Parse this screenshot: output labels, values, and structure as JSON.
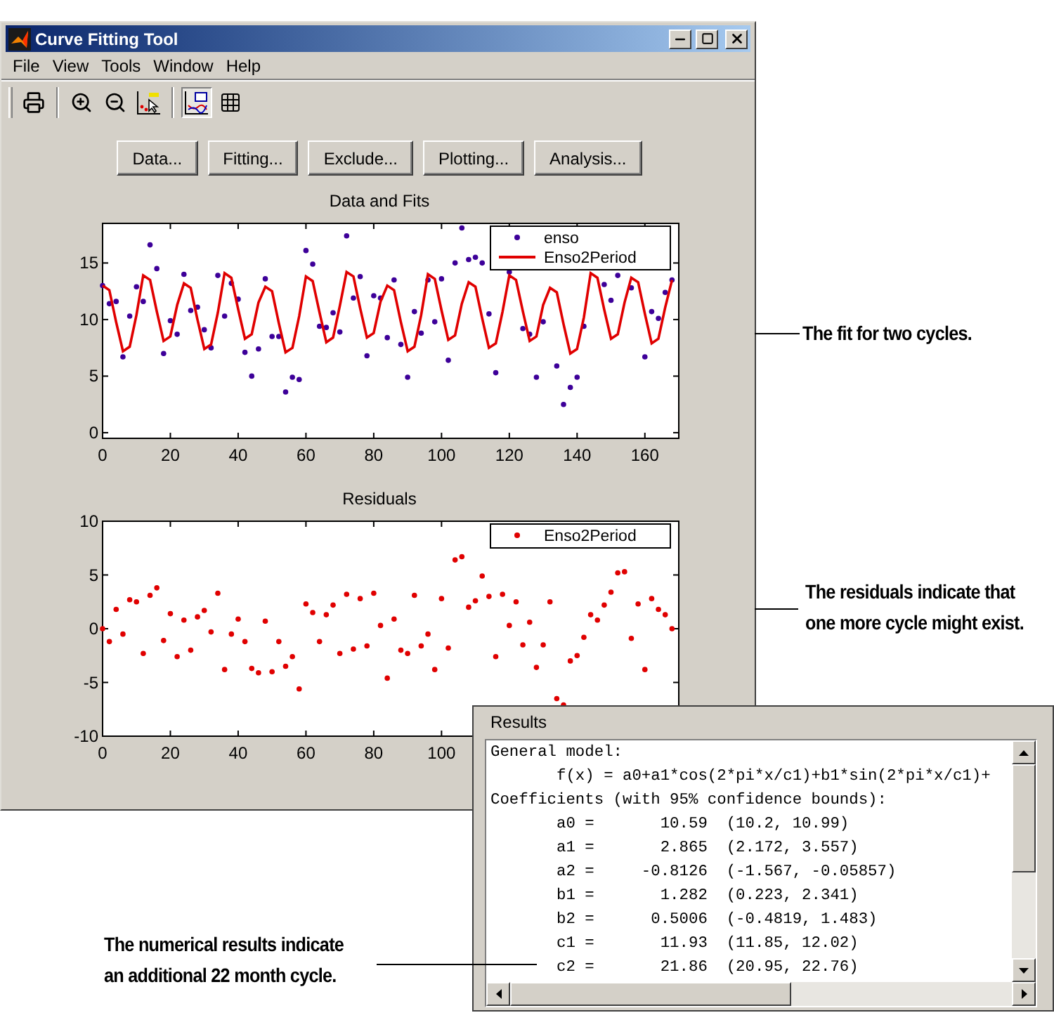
{
  "window": {
    "title": "Curve Fitting Tool"
  },
  "menu": [
    {
      "label": "File"
    },
    {
      "label": "View"
    },
    {
      "label": "Tools"
    },
    {
      "label": "Window"
    },
    {
      "label": "Help"
    }
  ],
  "toolbar": [
    {
      "kind": "printer",
      "pressed": false
    },
    {
      "kind": "zoom-in",
      "pressed": false
    },
    {
      "kind": "zoom-out",
      "pressed": false
    },
    {
      "kind": "data-cursor",
      "pressed": false
    },
    {
      "kind": "legend",
      "pressed": true
    },
    {
      "kind": "grid",
      "pressed": false
    }
  ],
  "buttons": [
    "Data...",
    "Fitting...",
    "Exclude...",
    "Plotting...",
    "Analysis..."
  ],
  "plots": [
    {
      "chart_data": {
        "type": "scatter",
        "title": "Data and Fits",
        "x": [
          0,
          2,
          4,
          6,
          8,
          10,
          12,
          14,
          16,
          18,
          20,
          22,
          24,
          26,
          28,
          30,
          32,
          34,
          36,
          38,
          40,
          42,
          44,
          46,
          48,
          50,
          52,
          54,
          56,
          58,
          60,
          62,
          64,
          66,
          68,
          70,
          72,
          74,
          76,
          78,
          80,
          82,
          84,
          86,
          88,
          90,
          92,
          94,
          96,
          98,
          100,
          102,
          104,
          106,
          108,
          110,
          112,
          114,
          116,
          118,
          120,
          122,
          124,
          126,
          128,
          130,
          132,
          134,
          136,
          138,
          140,
          142,
          144,
          146,
          148,
          150,
          152,
          154,
          156,
          158,
          160,
          162,
          164,
          166,
          168
        ],
        "xlim": [
          0,
          170
        ],
        "ylim": [
          -0.5,
          18.5
        ],
        "xticks": [
          0,
          20,
          40,
          60,
          80,
          100,
          120,
          140,
          160
        ],
        "yticks": [
          0,
          5,
          10,
          15
        ],
        "series": [
          {
            "name": "enso",
            "type": "scatter",
            "color": "#3d0099",
            "values": [
              13.0,
              11.4,
              11.6,
              6.7,
              10.3,
              12.9,
              11.6,
              16.6,
              14.5,
              7.0,
              9.9,
              8.7,
              14.0,
              10.8,
              11.1,
              9.1,
              7.5,
              13.9,
              10.3,
              13.2,
              11.8,
              7.1,
              5.0,
              7.4,
              13.6,
              8.5,
              8.5,
              3.6,
              4.9,
              4.7,
              16.1,
              14.9,
              9.4,
              9.3,
              10.6,
              8.9,
              17.4,
              11.9,
              13.8,
              6.8,
              12.1,
              11.9,
              8.4,
              13.5,
              7.8,
              4.9,
              10.7,
              8.8,
              13.5,
              9.8,
              13.6,
              6.4,
              15.0,
              18.1,
              15.3,
              15.5,
              15.0,
              10.5,
              5.3,
              null,
              14.2,
              null,
              9.2,
              8.7,
              4.9,
              9.8,
              null,
              5.9,
              2.5,
              4.0,
              4.9,
              9.4,
              null,
              null,
              13.1,
              11.7,
              13.9,
              null,
              12.8,
              null,
              6.7,
              10.7,
              10.1,
              12.4,
              13.5
            ]
          },
          {
            "name": "Enso2Period",
            "type": "line",
            "color": "#e00000",
            "values": [
              13.0,
              12.6,
              9.8,
              7.2,
              7.6,
              10.4,
              13.9,
              13.5,
              10.7,
              8.1,
              8.5,
              11.3,
              13.2,
              12.8,
              10.0,
              7.4,
              7.8,
              10.6,
              14.1,
              13.7,
              10.9,
              8.3,
              8.7,
              11.5,
              12.9,
              12.5,
              9.7,
              7.1,
              7.5,
              10.3,
              13.8,
              13.4,
              10.6,
              8.0,
              8.4,
              11.2,
              14.2,
              13.8,
              11.0,
              8.4,
              8.8,
              11.6,
              13.0,
              12.6,
              9.8,
              7.2,
              7.6,
              10.4,
              14.0,
              13.6,
              10.8,
              8.2,
              8.6,
              11.4,
              13.3,
              12.9,
              10.1,
              7.5,
              7.9,
              10.7,
              13.9,
              13.5,
              10.7,
              8.1,
              8.5,
              11.3,
              12.8,
              12.4,
              9.6,
              7.0,
              7.4,
              10.2,
              14.1,
              13.7,
              10.9,
              8.3,
              8.7,
              11.5,
              13.7,
              13.3,
              10.5,
              7.9,
              8.3,
              11.1,
              13.5
            ]
          }
        ],
        "legend": true
      }
    },
    {
      "chart_data": {
        "type": "scatter",
        "title": "Residuals",
        "x": [
          0,
          2,
          4,
          6,
          8,
          10,
          12,
          14,
          16,
          18,
          20,
          22,
          24,
          26,
          28,
          30,
          32,
          34,
          36,
          38,
          40,
          42,
          44,
          46,
          48,
          50,
          52,
          54,
          56,
          58,
          60,
          62,
          64,
          66,
          68,
          70,
          72,
          74,
          76,
          78,
          80,
          82,
          84,
          86,
          88,
          90,
          92,
          94,
          96,
          98,
          100,
          102,
          104,
          106,
          108,
          110,
          112,
          114,
          116,
          118,
          120,
          122,
          124,
          126,
          128,
          130,
          132,
          134,
          136,
          138,
          140,
          142,
          144,
          146,
          148,
          150,
          152,
          154,
          156,
          158,
          160,
          162,
          164,
          166,
          168
        ],
        "xlim": [
          0,
          170
        ],
        "ylim": [
          -10,
          10
        ],
        "xticks": [
          0,
          20,
          40,
          60,
          80,
          100
        ],
        "yticks": [
          -10,
          -5,
          0,
          5,
          10
        ],
        "series": [
          {
            "name": "Enso2Period",
            "type": "scatter",
            "color": "#e00000",
            "values": [
              0,
              -1.2,
              1.8,
              -0.5,
              2.7,
              2.5,
              -2.3,
              3.1,
              3.8,
              -1.1,
              1.4,
              -2.6,
              0.8,
              -2.0,
              1.1,
              1.7,
              -0.3,
              3.3,
              -3.8,
              -0.5,
              0.9,
              -1.2,
              -3.7,
              -4.1,
              0.7,
              -4.0,
              -1.2,
              -3.5,
              -2.6,
              -5.6,
              2.3,
              1.5,
              -1.2,
              1.3,
              2.2,
              -2.3,
              3.2,
              -1.9,
              2.8,
              -1.6,
              3.3,
              0.3,
              -4.6,
              0.9,
              -2.0,
              -2.3,
              3.1,
              -1.6,
              -0.5,
              -3.8,
              2.8,
              -1.8,
              6.4,
              6.7,
              2.0,
              2.6,
              4.9,
              3.0,
              -2.6,
              3.2,
              0.3,
              2.5,
              -1.5,
              0.6,
              -3.6,
              -1.5,
              2.5,
              -6.5,
              -7.1,
              -3.0,
              -2.5,
              -0.8,
              1.3,
              0.8,
              2.2,
              3.4,
              5.2,
              5.3,
              -0.9,
              2.3,
              -3.8,
              2.8,
              1.8,
              1.3,
              0
            ]
          }
        ],
        "legend": true
      }
    }
  ],
  "results": {
    "title": "Results",
    "lines": [
      "General model:",
      "       f(x) = a0+a1*cos(2*pi*x/c1)+b1*sin(2*pi*x/c1)+",
      "Coefficients (with 95% confidence bounds):",
      "       a0 =       10.59  (10.2, 10.99)",
      "       a1 =       2.865  (2.172, 3.557)",
      "       a2 =     -0.8126  (-1.567, -0.05857)",
      "       b1 =       1.282  (0.223, 2.341)",
      "       b2 =      0.5006  (-0.4819, 1.483)",
      "       c1 =       11.93  (11.85, 12.02)",
      "       c2 =       21.86  (20.95, 22.76)"
    ]
  },
  "callouts": [
    {
      "lines": [
        "The fit for two cycles."
      ]
    },
    {
      "lines": [
        "The residuals indicate that",
        "one more cycle might exist."
      ]
    },
    {
      "lines": [
        "The numerical results indicate",
        "an additional 22 month cycle."
      ]
    }
  ]
}
